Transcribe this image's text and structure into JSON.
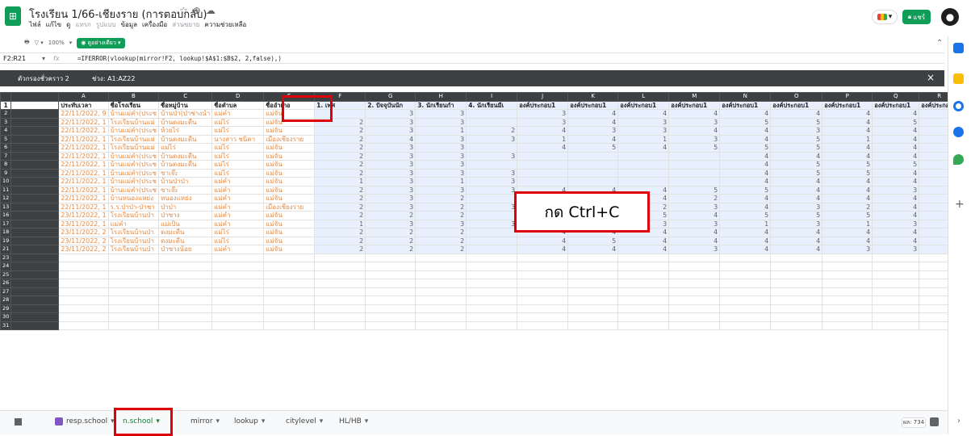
{
  "doc": {
    "title": "โรงเรียน 1/66-เชียงราย (การตอบกลับ)",
    "menu": [
      "ไฟล์",
      "แก้ไข",
      "ดู",
      "แทรก",
      "รูปแบบ",
      "ข้อมูล",
      "เครื่องมือ",
      "ส่วนขยาย",
      "ความช่วยเหลือ"
    ],
    "menu_dim": [
      false,
      false,
      false,
      true,
      true,
      false,
      false,
      true,
      false
    ],
    "share_label": "แชร์"
  },
  "toolbar": {
    "zoom": "100%",
    "filter_chip": "ดูอย่างเดียว"
  },
  "formula_bar": {
    "cell_ref": "F2:R21",
    "fx": "fx",
    "formula": "=IFERROR(vlookup(mirror!F2, lookup!$A$1:$B$2, 2,false),)"
  },
  "filter_view": {
    "name": "ตัวกรองชั่วคราว 2",
    "range_label": "ช่วง: A1:AZ22",
    "close": "×"
  },
  "columns": [
    "A",
    "B",
    "C",
    "D",
    "E",
    "F",
    "G",
    "H",
    "I",
    "J",
    "K",
    "L",
    "M",
    "N",
    "O",
    "P",
    "Q",
    "R"
  ],
  "headers": [
    "ประทับเวลา",
    "ชื่อโรงเรียน",
    "ชื่อหมู่บ้าน",
    "ชื่อตำบล",
    "ชื่ออำเภอ",
    "1. เพศ",
    "2. ปัจจุบันนัก",
    "3. นักเรียนกำ",
    "4. นักเรียนมีเ",
    "องค์ประกอบ1",
    "องค์ประกอบ1",
    "องค์ประกอบ1",
    "องค์ประกอบ1",
    "องค์ประกอบ1",
    "องค์ประกอบ1",
    "องค์ประกอบ1",
    "องค์ประกอบ1",
    "องค์ประกอบ1"
  ],
  "rows": [
    {
      "n": "2",
      "a": "22/11/2022, 9",
      "b": "บ้านแม่คำ(ประช",
      "c": "บ้านป่า(ป่าช่างน้ำ",
      "d": "แม่คำ",
      "e": "แม่จัน",
      "nums": [
        "",
        "3",
        "3",
        "",
        "3",
        "4",
        "4",
        "4",
        "4",
        "4",
        "4",
        "4",
        "4"
      ]
    },
    {
      "n": "3",
      "a": "22/11/2022, 1",
      "b": "โรงเรียนบ้านแม่",
      "c": "บ้านดงมะตื่น",
      "d": "แม่ไร่",
      "e": "แม่จัน",
      "nums": [
        "2",
        "3",
        "3",
        "",
        "3",
        "4",
        "3",
        "3",
        "5",
        "5",
        "4",
        "5",
        ""
      ]
    },
    {
      "n": "4",
      "a": "22/11/2022, 1",
      "b": "บ้านแม่คำ(ประช",
      "c": "ห้วยไร่",
      "d": "แม่ไร่",
      "e": "แม่จัน",
      "nums": [
        "2",
        "3",
        "1",
        "2",
        "4",
        "3",
        "3",
        "4",
        "4",
        "3",
        "4",
        "4",
        ""
      ]
    },
    {
      "n": "5",
      "a": "22/11/2022, 1",
      "b": "โรงเรียนบ้านแม่",
      "c": "บ้านดงมะตื่น",
      "d": "นางสาว ชนิดา",
      "e": "เมืองเชียงราย",
      "nums": [
        "2",
        "4",
        "3",
        "3",
        "1",
        "4",
        "1",
        "3",
        "4",
        "5",
        "1",
        "4",
        ""
      ]
    },
    {
      "n": "6",
      "a": "22/11/2022, 1",
      "b": "โรงเรียนบ้านแม่",
      "c": "แม่ไร่",
      "d": "แม่ไร่",
      "e": "แม่จัน",
      "nums": [
        "2",
        "3",
        "3",
        "",
        "4",
        "5",
        "4",
        "5",
        "5",
        "5",
        "4",
        "4",
        ""
      ]
    },
    {
      "n": "7",
      "a": "22/11/2022, 1",
      "b": "บ้านแม่คำ(ประช",
      "c": "บ้านดงมะตื่น",
      "d": "แม่ไร่",
      "e": "แม่จัน",
      "nums": [
        "2",
        "3",
        "3",
        "3",
        "",
        "",
        "",
        "",
        "4",
        "4",
        "4",
        "4",
        ""
      ]
    },
    {
      "n": "8",
      "a": "22/11/2022, 1",
      "b": "บ้านแม่คำ(ประช",
      "c": "บ้านดงมะตื่น",
      "d": "แม่ไร่",
      "e": "แม่จัน",
      "nums": [
        "2",
        "3",
        "3",
        "",
        "",
        "",
        "",
        "",
        "4",
        "5",
        "5",
        "5",
        ""
      ]
    },
    {
      "n": "9",
      "a": "22/11/2022, 1",
      "b": "บ้านแม่คำ(ประช",
      "c": "ซาเจ๊ะ",
      "d": "แม่ไร่",
      "e": "แม่จัน",
      "nums": [
        "2",
        "3",
        "3",
        "3",
        "",
        "",
        "",
        "",
        "4",
        "5",
        "5",
        "4",
        ""
      ]
    },
    {
      "n": "10",
      "a": "22/11/2022, 1",
      "b": "บ้านแม่คำ(ประช",
      "c": "บ้านป่าป่า",
      "d": "แม่คำ",
      "e": "แม่จัน",
      "nums": [
        "1",
        "3",
        "1",
        "3",
        "",
        "",
        "",
        "",
        "4",
        "4",
        "4",
        "4",
        ""
      ]
    },
    {
      "n": "11",
      "a": "22/11/2022, 1",
      "b": "บ้านแม่คำ(ประช",
      "c": "ซาเจ๊ะ",
      "d": "แม่คำ",
      "e": "แม่จัน",
      "nums": [
        "2",
        "3",
        "3",
        "3",
        "4",
        "4",
        "4",
        "5",
        "5",
        "4",
        "4",
        "3",
        ""
      ]
    },
    {
      "n": "12",
      "a": "22/11/2022, 1",
      "b": "บ้านหนองแหย่ง",
      "c": "หนองแหย่ง",
      "d": "แม่คำ",
      "e": "แม่จัน",
      "nums": [
        "2",
        "3",
        "2",
        "",
        "4",
        "4",
        "4",
        "2",
        "4",
        "4",
        "4",
        "4",
        ""
      ]
    },
    {
      "n": "13",
      "a": "22/11/2022, 1",
      "b": "ร.ร.ป่าป่า-ป่าชา",
      "c": "ป่าป่า",
      "d": "แม่คำ",
      "e": "เมืองเชียงราย",
      "nums": [
        "2",
        "3",
        "2",
        "3",
        "2",
        "4",
        "2",
        "3",
        "4",
        "3",
        "2",
        "4",
        ""
      ]
    },
    {
      "n": "16",
      "a": "23/11/2022, 1",
      "b": "โรงเรียนบ้านป่า",
      "c": "ป่าซาง",
      "d": "แม่คำ",
      "e": "แม่จัน",
      "nums": [
        "2",
        "2",
        "2",
        "",
        "4",
        "4",
        "5",
        "4",
        "5",
        "5",
        "5",
        "4",
        ""
      ]
    },
    {
      "n": "17",
      "a": "23/11/2022, 1",
      "b": "แม่คำ",
      "c": "แม่เป็น",
      "d": "แม่คำ",
      "e": "แม่จัน",
      "nums": [
        "1",
        "3",
        "3",
        "3",
        "3",
        "3",
        "3",
        "3",
        "1",
        "3",
        "1",
        "3",
        ""
      ]
    },
    {
      "n": "18",
      "a": "23/11/2022, 2",
      "b": "โรงเรียนบ้านป่า",
      "c": "ดงมะตื่น",
      "d": "แม่ไร่",
      "e": "แม่จัน",
      "nums": [
        "2",
        "2",
        "2",
        "",
        "4",
        "4",
        "4",
        "4",
        "4",
        "4",
        "4",
        "4",
        ""
      ]
    },
    {
      "n": "19",
      "a": "23/11/2022, 2",
      "b": "โรงเรียนบ้านป่า",
      "c": "ดงมะตื่น",
      "d": "แม่ไร่",
      "e": "แม่จัน",
      "nums": [
        "2",
        "2",
        "2",
        "",
        "4",
        "5",
        "4",
        "4",
        "4",
        "4",
        "4",
        "4",
        ""
      ]
    },
    {
      "n": "21",
      "a": "23/11/2022, 2",
      "b": "โรงเรียนบ้านป่า",
      "c": "ป่าซางน้อย",
      "d": "แม่คำ",
      "e": "แม่จัน",
      "nums": [
        "2",
        "2",
        "2",
        "",
        "4",
        "4",
        "4",
        "3",
        "4",
        "4",
        "3",
        "3",
        ""
      ]
    }
  ],
  "empty_rows": [
    "23",
    "24",
    "25",
    "26",
    "27",
    "28",
    "29",
    "30",
    "31"
  ],
  "callout": "กด Ctrl+C",
  "tabs": [
    {
      "label": "resp.school",
      "arrow": "▾"
    },
    {
      "label": "n.school",
      "arrow": "▾"
    },
    {
      "label": "mirror",
      "arrow": "▾"
    },
    {
      "label": "lookup",
      "arrow": "▾"
    },
    {
      "label": "citylevel",
      "arrow": "▾"
    },
    {
      "label": "HL/HB",
      "arrow": "▾"
    }
  ],
  "sum_label": "ผล: 734",
  "colors": {
    "accent": "#0f9d58",
    "highlight": "#e0000a",
    "selection": "#e8f0fe"
  }
}
